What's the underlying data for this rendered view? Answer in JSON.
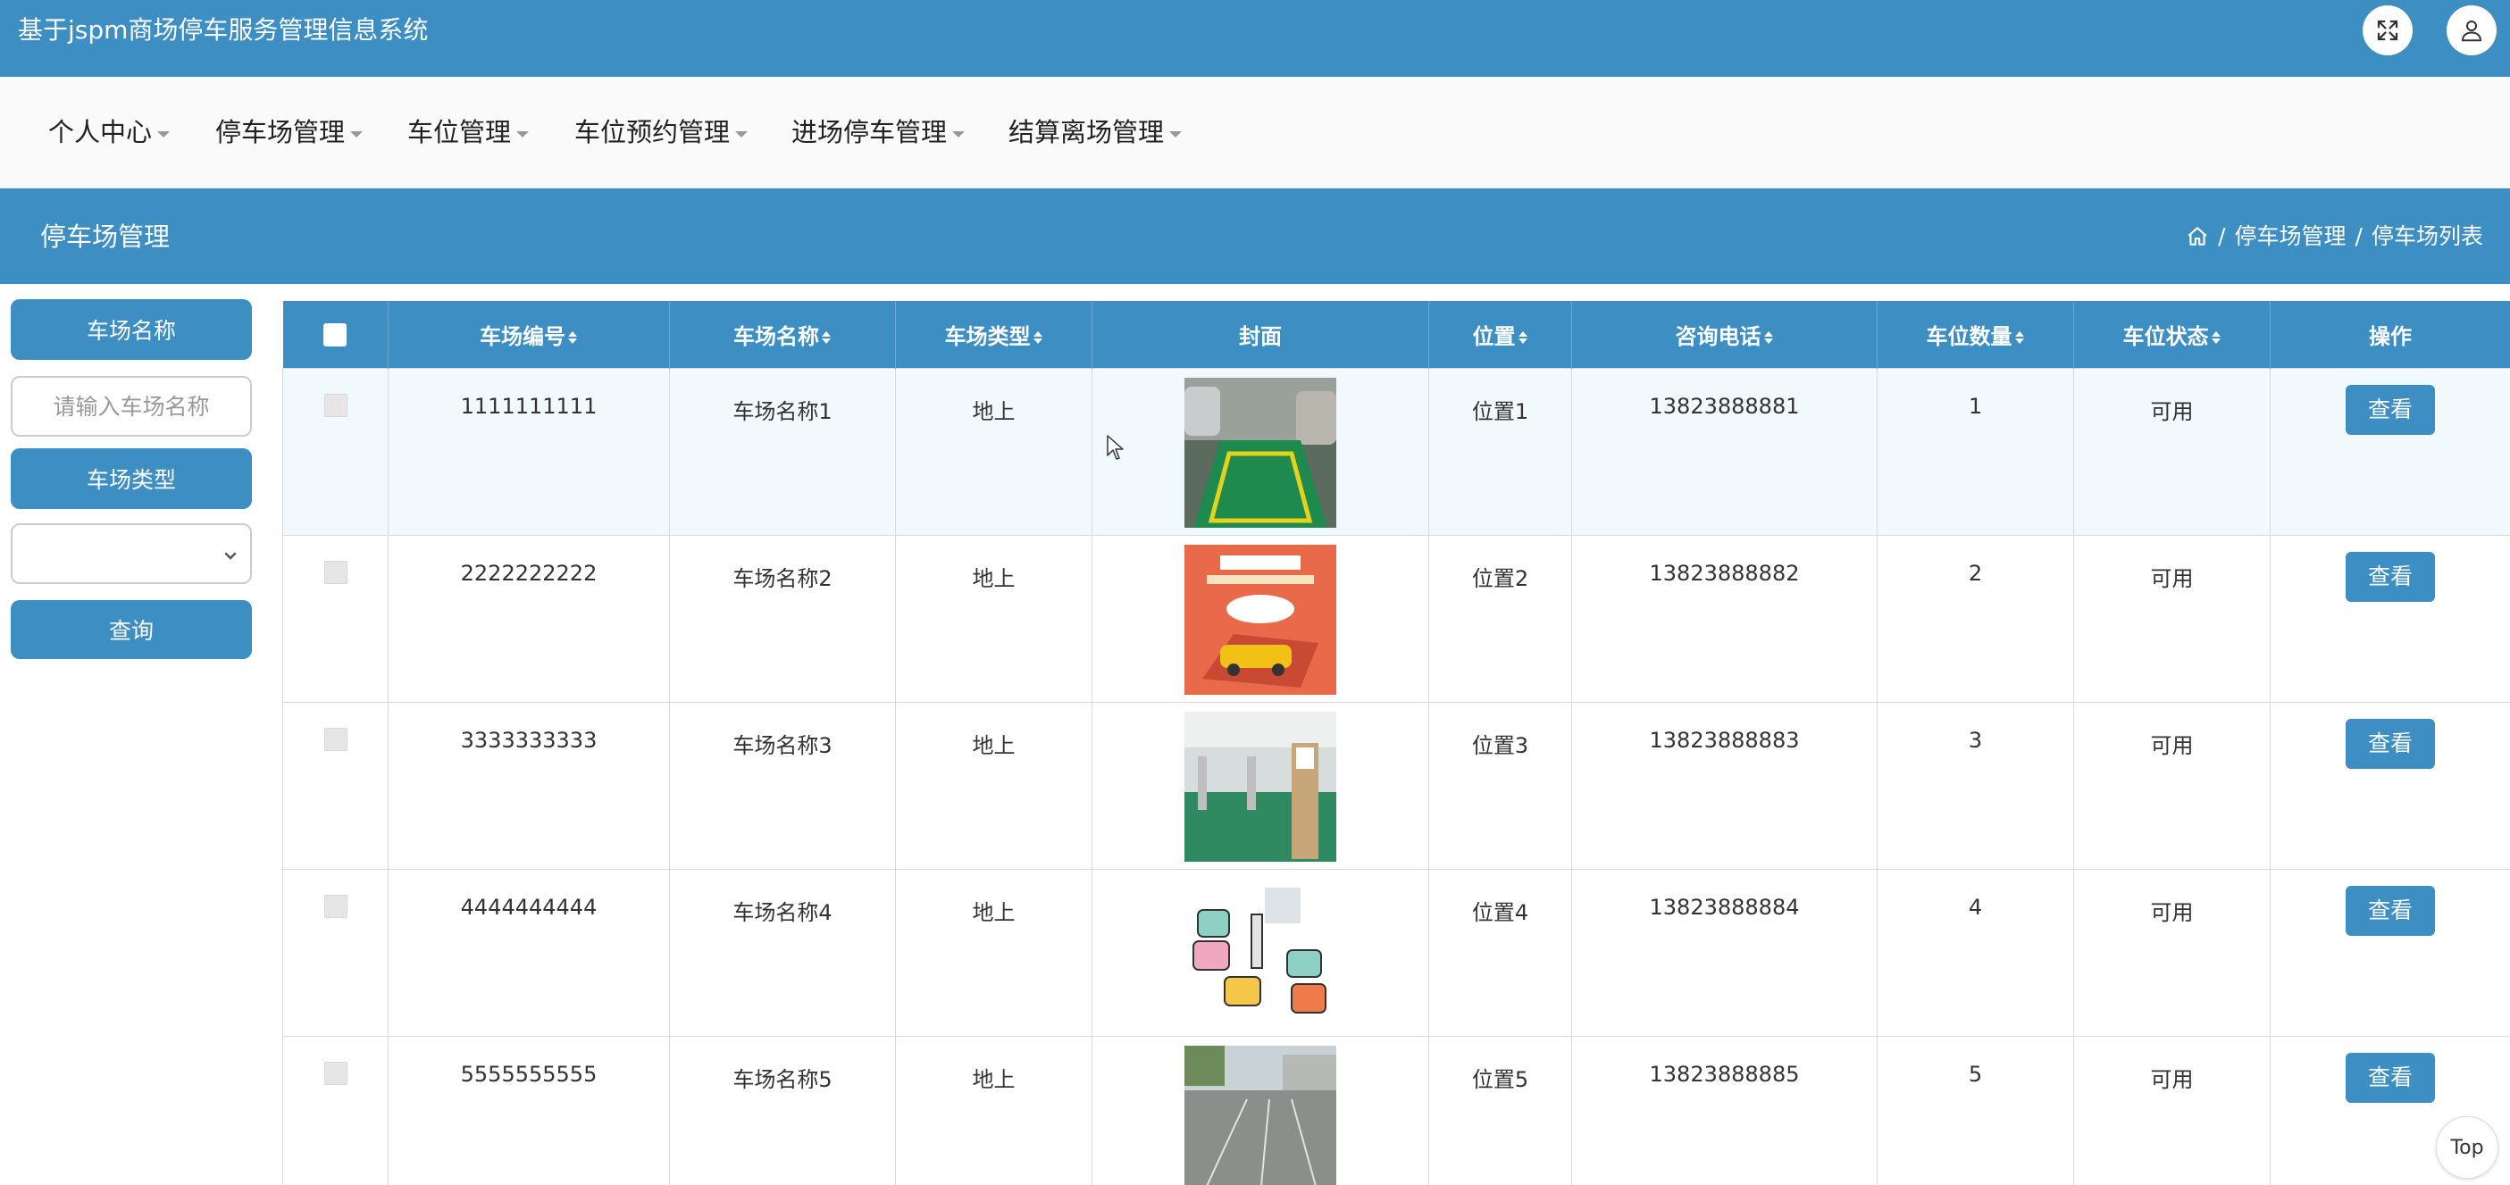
{
  "app": {
    "title": "基于jspm商场停车服务管理信息系统"
  },
  "header_icons": [
    "fullscreen-icon",
    "user-icon"
  ],
  "nav": {
    "items": [
      {
        "label": "个人中心"
      },
      {
        "label": "停车场管理"
      },
      {
        "label": "车位管理"
      },
      {
        "label": "车位预约管理"
      },
      {
        "label": "进场停车管理"
      },
      {
        "label": "结算离场管理"
      }
    ]
  },
  "section": {
    "title": "停车场管理",
    "breadcrumb": [
      "停车场管理",
      "停车场列表"
    ],
    "separator": "/"
  },
  "filters": {
    "name_label": "车场名称",
    "name_placeholder": "请输入车场名称",
    "type_label": "车场类型",
    "type_value": "",
    "query_label": "查询"
  },
  "table": {
    "headers": [
      "车场编号",
      "车场名称",
      "车场类型",
      "封面",
      "位置",
      "咨询电话",
      "车位数量",
      "车位状态",
      "操作"
    ],
    "rows": [
      {
        "code": "1111111111",
        "name": "车场名称1",
        "type": "地上",
        "location": "位置1",
        "phone": "13823888881",
        "count": "1",
        "status": "可用",
        "action": "查看"
      },
      {
        "code": "2222222222",
        "name": "车场名称2",
        "type": "地上",
        "location": "位置2",
        "phone": "13823888882",
        "count": "2",
        "status": "可用",
        "action": "查看"
      },
      {
        "code": "3333333333",
        "name": "车场名称3",
        "type": "地上",
        "location": "位置3",
        "phone": "13823888883",
        "count": "3",
        "status": "可用",
        "action": "查看"
      },
      {
        "code": "4444444444",
        "name": "车场名称4",
        "type": "地上",
        "location": "位置4",
        "phone": "13823888884",
        "count": "4",
        "status": "可用",
        "action": "查看"
      },
      {
        "code": "5555555555",
        "name": "车场名称5",
        "type": "地上",
        "location": "位置5",
        "phone": "13823888885",
        "count": "5",
        "status": "可用",
        "action": "查看"
      }
    ]
  },
  "back_to_top": "Top",
  "colors": {
    "primary": "#3d8ec3",
    "row_highlight": "#f1f9fd"
  }
}
